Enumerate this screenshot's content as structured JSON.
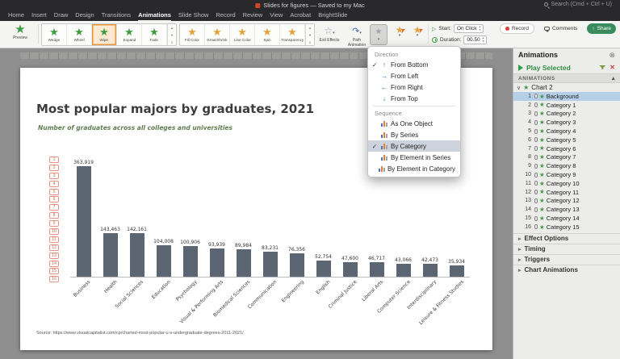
{
  "icons": {
    "star": "★",
    "star_outline": "☆",
    "chevron_down": "▾",
    "triangle_up": "▴",
    "triangle_down": "▾",
    "more": "≡",
    "check": "✓",
    "play_outline": "▷",
    "caret_collapse": "∨",
    "caret_right": "▸",
    "caret_up": "▴",
    "close": "✕",
    "close_circle": "⊗",
    "share_arrow": "↑",
    "path_arrow": "↷",
    "arrow_up": "↑",
    "arrow_down": "↓",
    "arrow_left": "←",
    "arrow_right": "→"
  },
  "colors": {
    "accent_orange": "#e8953f",
    "entrance_green": "#3f9b3f",
    "emphasis_gold": "#e2a33c",
    "bar_color": "#5b6672",
    "selection_blue": "#b5cfe9",
    "menu_highlight": "#ccd3dc",
    "share_green": "#3a8c5f",
    "badge_orange": "#cf6a50"
  },
  "titlebar": {
    "title": "Slides for figures — Saved to my Mac",
    "search": "Search (Cmd + Ctrl + U)",
    "tabs": [
      {
        "label": "Home"
      },
      {
        "label": "Insert"
      },
      {
        "label": "Draw"
      },
      {
        "label": "Design"
      },
      {
        "label": "Transitions"
      },
      {
        "label": "Animations",
        "active": true
      },
      {
        "label": "Slide Show"
      },
      {
        "label": "Record"
      },
      {
        "label": "Review"
      },
      {
        "label": "View"
      },
      {
        "label": "Acrobat"
      },
      {
        "label": "BrightSlide"
      }
    ]
  },
  "ribbon": {
    "preview_label": "Preview",
    "entrance_effects": [
      {
        "label": "Wedge"
      },
      {
        "label": "Wheel"
      },
      {
        "label": "Wipe",
        "selected": true
      },
      {
        "label": "Expand"
      },
      {
        "label": "Fade"
      }
    ],
    "emphasis_effects": [
      {
        "label": "Fill Color"
      },
      {
        "label": "Grow/Shrink"
      },
      {
        "label": "Line Color"
      },
      {
        "label": "Spin"
      },
      {
        "label": "Transparency"
      }
    ],
    "exit_effects_label": "Exit Effects",
    "path_animation_label": "Path Animation",
    "start_label": "Start:",
    "start_value": "On Click",
    "duration_label": "Duration:",
    "duration_value": "00.50",
    "record_label": "Record",
    "comments_label": "Comments",
    "share_label": "Share"
  },
  "effect_options_menu": {
    "direction_header": "Direction",
    "direction_items": [
      {
        "label": "From Bottom",
        "arrow": "up",
        "checked": true
      },
      {
        "label": "From Left",
        "arrow": "right"
      },
      {
        "label": "From Right",
        "arrow": "left"
      },
      {
        "label": "From Top",
        "arrow": "down"
      }
    ],
    "sequence_header": "Sequence",
    "sequence_items": [
      {
        "label": "As One Object"
      },
      {
        "label": "By Series"
      },
      {
        "label": "By Category",
        "checked": true,
        "highlighted": true
      },
      {
        "label": "By Element in Series"
      },
      {
        "label": "By Element in Category"
      }
    ]
  },
  "animations_panel": {
    "title": "Animations",
    "play_selected_label": "Play Selected",
    "list_header": "ANIMATIONS",
    "group_label": "Chart 2",
    "items": [
      {
        "num": 1,
        "label": "Background",
        "selected": true
      },
      {
        "num": 2,
        "label": "Category 1"
      },
      {
        "num": 3,
        "label": "Category 2"
      },
      {
        "num": 4,
        "label": "Category 3"
      },
      {
        "num": 5,
        "label": "Category 4"
      },
      {
        "num": 6,
        "label": "Category 5"
      },
      {
        "num": 7,
        "label": "Category 6"
      },
      {
        "num": 8,
        "label": "Category 7"
      },
      {
        "num": 9,
        "label": "Category 8"
      },
      {
        "num": 10,
        "label": "Category 9"
      },
      {
        "num": 11,
        "label": "Category 10"
      },
      {
        "num": 12,
        "label": "Category 11"
      },
      {
        "num": 13,
        "label": "Category 12"
      },
      {
        "num": 14,
        "label": "Category 13"
      },
      {
        "num": 15,
        "label": "Category 14"
      },
      {
        "num": 16,
        "label": "Category 15"
      }
    ],
    "sections": [
      "Effect Options",
      "Timing",
      "Triggers",
      "Chart Animations"
    ]
  },
  "slide": {
    "source": "Source: https://www.visualcapitalist.com/cp/charted-most-popular-u-s-undergraduate-degrees-2011-2021/",
    "animation_badges": [
      1,
      2,
      3,
      4,
      5,
      6,
      7,
      8,
      9,
      10,
      11,
      12,
      13,
      14,
      15,
      16
    ]
  },
  "chart_data": {
    "type": "bar",
    "title": "Most popular majors by graduates, 2021",
    "subtitle": "Number of graduates across all colleges and universities",
    "categories": [
      "Business",
      "Health",
      "Social Sciences",
      "Education",
      "Psychology",
      "Visual & Performing Arts",
      "Biomedical Sciences",
      "Communication",
      "Engineering",
      "English",
      "Criminal Justice",
      "Liberal Arts",
      "Computer Science",
      "Interdisciplinary",
      "Leisure & Fitness Studies"
    ],
    "values": [
      363919,
      143463,
      142161,
      104008,
      100906,
      93939,
      89984,
      83231,
      76356,
      52754,
      47600,
      46717,
      43066,
      42473,
      35934
    ],
    "labels": [
      "363,919",
      "143,463",
      "142,161",
      "104,008",
      "100,906",
      "93,939",
      "89,984",
      "83,231",
      "76,356",
      "52,754",
      "47,600",
      "46,717",
      "43,066",
      "42,473",
      "35,934"
    ],
    "ylim": [
      0,
      400000
    ],
    "grid": false,
    "legend": false,
    "bar_color": "#5b6672"
  }
}
